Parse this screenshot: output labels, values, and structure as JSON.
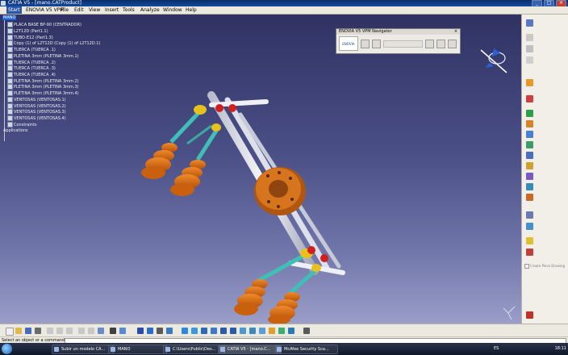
{
  "window": {
    "title": "CATIA V5 - [mano.CATProduct]",
    "controls": [
      "_",
      "□",
      "×"
    ]
  },
  "menubar": {
    "items": [
      "Start",
      "ENOVIA V5 VPM",
      "File",
      "Edit",
      "View",
      "Insert",
      "Tools",
      "Analyze",
      "Window",
      "Help"
    ]
  },
  "tree": {
    "root": "MANO",
    "nodes": [
      "PLACA BASE BP-90 (CENTRADOR)",
      "L2T12D (Part1.1)",
      "TUBO-E12 (Part1.3)",
      "Copy (1) of L2T12D (Copy (1) of L2T12D.1)",
      "TUERCA (TUERCA .1)",
      "PLETINA 3mm (PLETINA 3mm.1)",
      "TUERCA (TUERCA .2)",
      "TUERCA (TUERCA .3)",
      "TUERCA (TUERCA .4)",
      "PLETINA 3mm (PLETINA 3mm.2)",
      "PLETINA 3mm (PLETINA 3mm.3)",
      "PLETINA 3mm (PLETINA 3mm.4)",
      "VENTOSAS (VENTOSAS.1)",
      "VENTOSAS (VENTOSAS.2)",
      "VENTOSAS (VENTOSAS.3)",
      "VENTOSAS (VENTOSAS.4)"
    ],
    "constraints": "Constraints",
    "applications": "Applications"
  },
  "navigator": {
    "title": "ENOVIA V5 VPM Navigator",
    "logo": "ENOVIA",
    "close": "×"
  },
  "status": {
    "message": "Select an object or a command"
  },
  "taskbar": {
    "items": [
      "Subir un modelo CA...",
      "MANO",
      "C:\\Users\\Public\\Des...",
      "CATIA V5 - [mano.C...",
      "McAfee Security Sca..."
    ],
    "language": "ES",
    "clock": "18:11"
  },
  "rightbar": {
    "hint": "Create Piece Drawing"
  },
  "colors": {
    "viewport_top": "#2f3263",
    "viewport_bottom": "#9a9ec8",
    "cup_orange": "#e06a12",
    "arm_teal": "#3fbfb5",
    "tube_white": "#e8eaf2",
    "flange_brown": "#9a4c10",
    "title_blue": "#154a9c"
  }
}
